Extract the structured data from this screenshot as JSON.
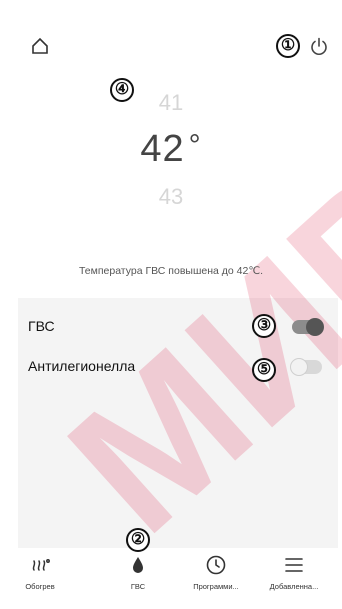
{
  "colors": {
    "watermark": "#d9002e",
    "accent": "#555555"
  },
  "callouts": [
    "①",
    "②",
    "③",
    "④",
    "⑤"
  ],
  "top_bar": {
    "home_icon": "home-icon",
    "power_icon": "power-icon"
  },
  "temperature": {
    "previous": "41",
    "current": "42",
    "unit": "°",
    "next": "43"
  },
  "status_text": "Температура ГВС повышена до 42℃.",
  "settings": {
    "dhw": {
      "label": "ГВС",
      "enabled": true
    },
    "anti_legionella": {
      "label": "Антилегионелла",
      "enabled": false
    }
  },
  "bottom_nav": {
    "items": [
      {
        "label": "Обогрев",
        "icon": "heating-icon"
      },
      {
        "label": "ГВС",
        "icon": "water-drop-icon"
      },
      {
        "label": "Программи...",
        "icon": "clock-icon"
      },
      {
        "label": "Добавленна...",
        "icon": "menu-icon"
      }
    ]
  },
  "watermark_text": "МИР"
}
